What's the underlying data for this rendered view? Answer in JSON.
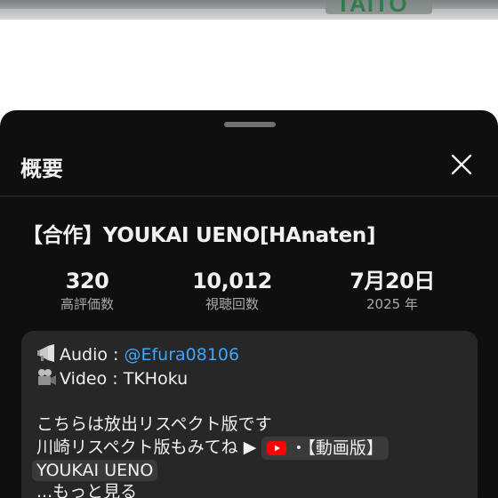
{
  "video_strip": {
    "sign_text": "TAITO"
  },
  "sheet": {
    "title": "概要",
    "video_title": "【合作】YOUKAI UENO[HAnaten]",
    "stats": {
      "likes": {
        "value": "320",
        "label": "高評価数"
      },
      "views": {
        "value": "10,012",
        "label": "視聴回数"
      },
      "date": {
        "value": "7月20日",
        "label": "2025 年"
      }
    },
    "description": {
      "audio_label": "Audio :",
      "audio_handle": "@Efura08106",
      "video_line": "Video : TKHoku",
      "line3": "こちらは放出リスペクト版です",
      "line4_prefix": "川崎リスペクト版もみてね ▶",
      "link_chip_text": "・【動画版】",
      "line5": "YOUKAI UENO",
      "more": "...もっと見る"
    }
  },
  "icons": {
    "close": "close-icon",
    "handle": "drag-handle",
    "megaphone": "megaphone-icon",
    "camera": "movie-camera-icon",
    "youtube": "youtube-icon"
  },
  "colors": {
    "sheet_bg": "#0f0f0f",
    "card_bg": "#272727",
    "link": "#3ea6ff",
    "youtube_red": "#ff0000"
  }
}
